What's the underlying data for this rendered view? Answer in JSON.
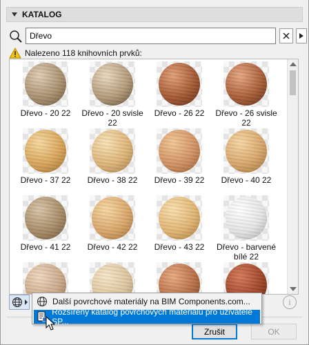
{
  "catalog": {
    "title": "KATALOG"
  },
  "search": {
    "value": "Dřevo"
  },
  "status": {
    "text": "Nalezeno 118 knihovních prvků:"
  },
  "materials": [
    {
      "label": "Dřevo - 20 22",
      "colors": [
        "#e0cdb5",
        "#a9906f",
        "#6b543a"
      ]
    },
    {
      "label": "Dřevo - 20 svisle 22",
      "colors": [
        "#ead9c0",
        "#b39a79",
        "#5e4931"
      ]
    },
    {
      "label": "Dřevo - 26 22",
      "colors": [
        "#e2a07a",
        "#a35832",
        "#5a2a14"
      ]
    },
    {
      "label": "Dřevo - 26 svisle 22",
      "colors": [
        "#e6a683",
        "#a85d37",
        "#5c2c16"
      ]
    },
    {
      "label": "Dřevo - 37 22",
      "colors": [
        "#f6d9a0",
        "#d7a45a",
        "#9a6b2c"
      ]
    },
    {
      "label": "Dřevo - 38 22",
      "colors": [
        "#f8e2b6",
        "#ddb478",
        "#a17a44"
      ]
    },
    {
      "label": "Dřevo - 39 22",
      "colors": [
        "#f2c795",
        "#d09162",
        "#93592f"
      ]
    },
    {
      "label": "Dřevo - 40 22",
      "colors": [
        "#f6d6a4",
        "#d7a66b",
        "#9a6d36"
      ]
    },
    {
      "label": "Dřevo - 41 22",
      "colors": [
        "#d8c4a6",
        "#a68b67",
        "#6d5639"
      ]
    },
    {
      "label": "Dřevo - 42 22",
      "colors": [
        "#f7d7a4",
        "#d9a66a",
        "#9c6d38"
      ]
    },
    {
      "label": "Dřevo - 43 22",
      "colors": [
        "#f9e0ae",
        "#e0b472",
        "#a5773a"
      ]
    },
    {
      "label": "Dřevo - barvené bílé 22",
      "colors": [
        "#ffffff",
        "#e4e4e4",
        "#a8a8a8"
      ]
    },
    {
      "label": "",
      "colors": [
        "#f0d8c0",
        "#c9a888",
        "#8a6a4d"
      ]
    },
    {
      "label": "",
      "colors": [
        "#f7e6c8",
        "#dcc39d",
        "#a28a62"
      ]
    },
    {
      "label": "",
      "colors": [
        "#e8a982",
        "#b56e45",
        "#6e3a1d"
      ]
    },
    {
      "label": "",
      "colors": [
        "#d47a5a",
        "#9e4428",
        "#5a200d"
      ]
    }
  ],
  "popup": {
    "item1": "Další povrchové materiály na BIM Components.com...",
    "item2": "Rozšířený katalog povrchových materiálů pro uživatele SP..."
  },
  "buttons": {
    "cancel": "Zrušit",
    "ok": "OK"
  }
}
